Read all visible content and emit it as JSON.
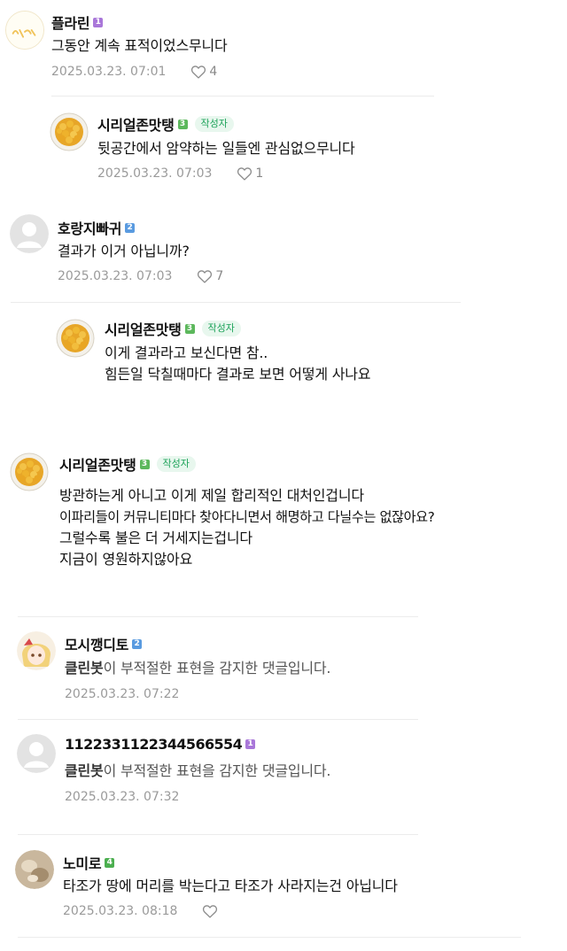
{
  "colors": {
    "lv1": "#a977d9",
    "lv2": "#5a9be0",
    "lv3": "#5cb85c",
    "lv4": "#4caf50",
    "author_badge_text": "#1ea35a",
    "author_badge_bg": "#e8f7ee",
    "meta_text": "#9a9a9a"
  },
  "author_badge_label": "작성자",
  "comments": [
    {
      "nickname": "플라린",
      "level": "1",
      "lines": [
        "그동안 계속 표적이었스무니다"
      ],
      "date": "2025.03.23. 07:01",
      "likes": "4",
      "avatar": "doodle-avatar"
    },
    {
      "nickname": "시리얼존맛탱",
      "level": "3",
      "author": "작성자",
      "lines": [
        "뒷공간에서 암약하는 일들엔 관심없으무니다"
      ],
      "date": "2025.03.23. 07:03",
      "likes": "1",
      "avatar": "corn-cereal-avatar"
    },
    {
      "nickname": "호랑지빠귀",
      "level": "2",
      "lines": [
        "결과가 이거 아닙니까?"
      ],
      "date": "2025.03.23. 07:03",
      "likes": "7",
      "avatar": "default-avatar"
    },
    {
      "nickname": "시리얼존맛탱",
      "level": "3",
      "author": "작성자",
      "lines": [
        "이게 결과라고 보신다면 참..",
        "힘든일 닥칠때마다 결과로 보면 어떻게 사나요"
      ],
      "avatar": "corn-cereal-avatar"
    },
    {
      "nickname": "시리얼존맛탱",
      "level": "3",
      "author": "작성자",
      "lines": [
        "방관하는게 아니고 이게 제일 합리적인 대처인겁니다",
        "이파리들이 커뮤니티마다 찾아다니면서 해명하고 다닐수는 없잖아요?",
        "그럴수록 불은 더 거세지는겁니다",
        "지금이 영원하지않아요"
      ],
      "avatar": "corn-cereal-avatar"
    },
    {
      "nickname": "모시깽디토",
      "level": "2",
      "cleanbot": "클린봇",
      "cleanbot_text": "이 부적절한 표현을 감지한 댓글입니다.",
      "date": "2025.03.23. 07:22",
      "avatar": "anime-avatar"
    },
    {
      "nickname": "1122331122344566554",
      "level": "1",
      "cleanbot": "클린봇",
      "cleanbot_text": "이 부적절한 표현을 감지한 댓글입니다.",
      "date": "2025.03.23. 07:32",
      "avatar": "default-avatar"
    },
    {
      "nickname": "노미로",
      "level": "4",
      "lines": [
        "타조가 땅에 머리를 박는다고 타조가 사라지는건 아닙니다"
      ],
      "date": "2025.03.23. 08:18",
      "likes": "",
      "avatar": "photo-avatar"
    }
  ]
}
